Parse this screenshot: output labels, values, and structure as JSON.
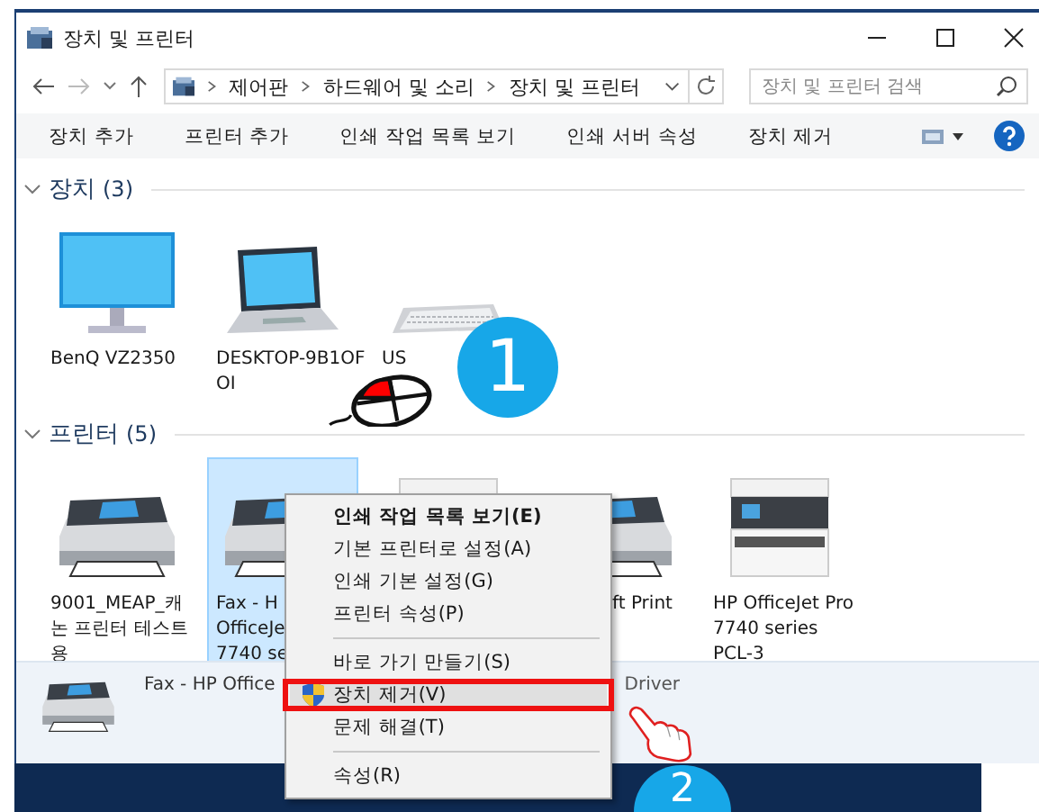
{
  "window": {
    "title": "장치 및 프린터"
  },
  "address_bar": {
    "path": [
      "제어판",
      "하드웨어 및 소리",
      "장치 및 프린터"
    ]
  },
  "search": {
    "placeholder": "장치 및 프린터 검색"
  },
  "toolbar": [
    "장치 추가",
    "프린터 추가",
    "인쇄 작업 목록 보기",
    "인쇄 서버 속성",
    "장치 제거"
  ],
  "groups": [
    {
      "title": "장치",
      "count": "(3)",
      "expanded": true,
      "items": [
        {
          "kind": "monitor",
          "lines": [
            "BenQ VZ2350"
          ],
          "selected": false
        },
        {
          "kind": "laptop",
          "lines": [
            "DESKTOP-9B1OF",
            "OI"
          ],
          "selected": false
        },
        {
          "kind": "keyboard",
          "lines": [
            "US"
          ],
          "selected": false
        }
      ]
    },
    {
      "title": "프린터",
      "count": "(5)",
      "expanded": true,
      "items": [
        {
          "kind": "printer",
          "lines": [
            "9001_MEAP_캐",
            "논 프린터 테스트",
            "용"
          ],
          "selected": false
        },
        {
          "kind": "printer",
          "lines": [
            "Fax - H",
            "OfficeJe",
            "7740 se"
          ],
          "selected": true
        },
        {
          "kind": "inkjet",
          "selected": false
        },
        {
          "kind": "printer",
          "lines": [
            "ft Print"
          ],
          "covered_start": true,
          "selected": false
        },
        {
          "kind": "inkjet",
          "lines": [
            "HP OfficeJet Pro",
            "7740 series",
            "PCL-3"
          ],
          "selected": false
        }
      ]
    }
  ],
  "details": {
    "name": "Fax - HP Office",
    "field": "Driver"
  },
  "context_menu": {
    "items": [
      {
        "kind": "item",
        "label": "인쇄 작업 목록 보기(E)",
        "default": true,
        "highlighted": false
      },
      {
        "kind": "item",
        "label": "기본 프린터로 설정(A)",
        "default": false,
        "highlighted": false
      },
      {
        "kind": "item",
        "label": "인쇄 기본 설정(G)",
        "default": false,
        "highlighted": false
      },
      {
        "kind": "item",
        "label": "프린터 속성(P)",
        "default": false,
        "highlighted": false
      },
      {
        "kind": "separator"
      },
      {
        "kind": "item",
        "label": "바로 가기 만들기(S)",
        "default": false,
        "highlighted": false
      },
      {
        "kind": "shield",
        "label": "장치 제거(V)",
        "default": false,
        "highlighted": true
      },
      {
        "kind": "item",
        "label": "문제 해결(T)",
        "default": false,
        "highlighted": false
      },
      {
        "kind": "separator"
      },
      {
        "kind": "item",
        "label": "속성(R)",
        "default": false,
        "highlighted": false
      }
    ]
  },
  "tutorial": {
    "steps": [
      "1",
      "2"
    ]
  }
}
